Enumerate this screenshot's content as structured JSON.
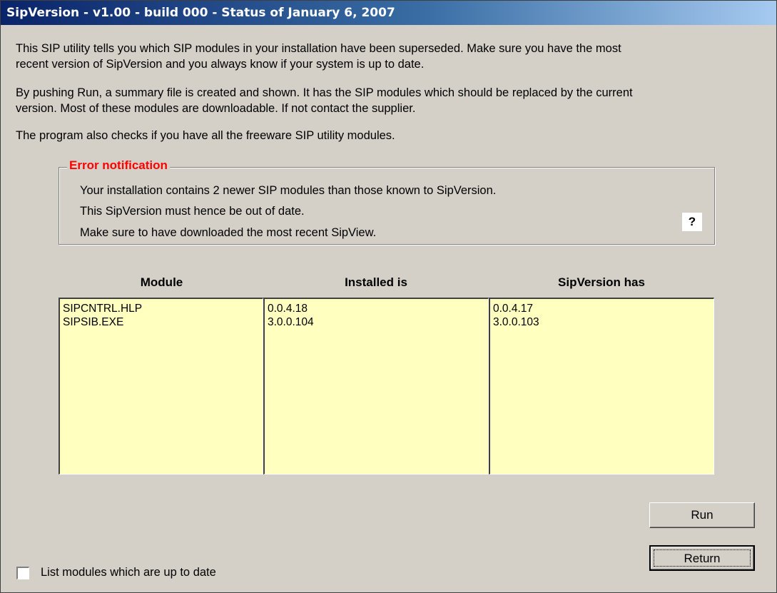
{
  "window": {
    "title": "SipVersion - v1.00 - build 000 - Status of January 6, 2007"
  },
  "intro": {
    "p1_line1": "This SIP utility tells you which SIP modules in your installation have been superseded. Make sure you have the most",
    "p1_line2": "recent version of SipVersion and you always know if your system is up to date.",
    "p2_line1": "By pushing Run, a summary file is created and shown. It has the SIP modules which should be replaced by the current",
    "p2_line2": "version. Most of these modules are downloadable. If not contact the supplier.",
    "p3": "The program also checks if you have all the freeware SIP utility modules."
  },
  "error_group": {
    "title": "Error notification",
    "lines": [
      "Your installation contains 2 newer SIP modules than those known to SipVersion.",
      "This SipVersion must hence be out of date.",
      "Make sure to have downloaded the most recent SipView."
    ],
    "help_label": "?"
  },
  "table": {
    "headers": [
      "Module",
      "Installed is",
      "SipVersion has"
    ],
    "modules": [
      "SIPCNTRL.HLP",
      "SIPSIB.EXE"
    ],
    "installed": [
      "0.0.4.18",
      "3.0.0.104"
    ],
    "sipversion": [
      "0.0.4.17",
      "3.0.0.103"
    ]
  },
  "buttons": {
    "run": "Run",
    "return": "Return"
  },
  "options": {
    "list_up_to_date_label": "List modules which are up to date",
    "list_up_to_date_checked": false
  },
  "colors": {
    "list_background": "#ffffc0",
    "error_title": "#ff0000",
    "titlebar_start": "#0a246a",
    "dialog_face": "#d4d0c8"
  }
}
